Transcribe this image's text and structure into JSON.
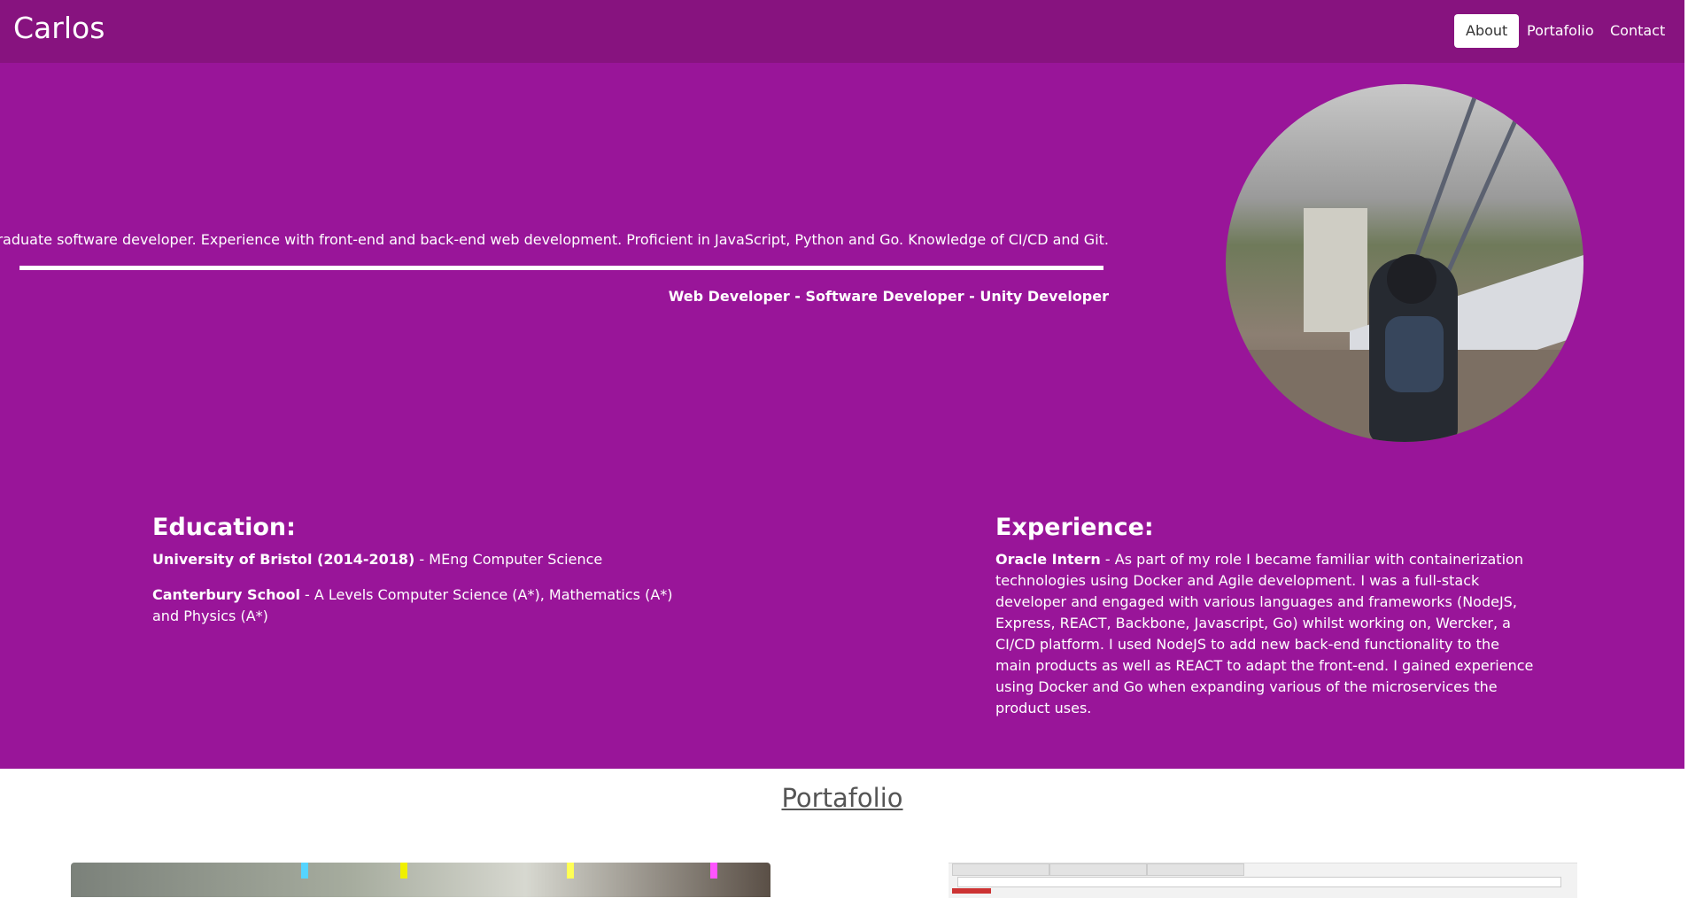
{
  "nav": {
    "brand": "Carlos",
    "items": [
      {
        "label": "About",
        "active": true
      },
      {
        "label": "Portafolio",
        "active": false
      },
      {
        "label": "Contact",
        "active": false
      }
    ]
  },
  "hero": {
    "intro": "Graduate software developer. Experience with front-end and back-end web development. Proficient in JavaScript, Python and Go. Knowledge of CI/CD and Git.",
    "roles": "Web Developer - Software Developer - Unity Developer"
  },
  "education": {
    "title": "Education:",
    "items": [
      {
        "name": "University of Bristol (2014-2018)",
        "detail": " - MEng Computer Science"
      },
      {
        "name": "Canterbury School",
        "detail": " - A Levels Computer Science (A*), Mathematics (A*) and Physics (A*)"
      }
    ]
  },
  "experience": {
    "title": "Experience:",
    "items": [
      {
        "name": "Oracle Intern",
        "detail": " - As part of my role I became familiar with containerization technologies using Docker and Agile development. I was a full-stack developer and engaged with various languages and frameworks (NodeJS, Express, REACT, Backbone, Javascript, Go) whilst working on, Wercker, a CI/CD platform. I used NodeJS to add new back-end functionality to the main products as well as REACT to adapt the front-end. I gained experience using Docker and Go when expanding various of the microservices the product uses."
      }
    ]
  },
  "portfolio": {
    "title": "Portafolio"
  },
  "colors": {
    "navbar": "#87137f",
    "hero": "#991599",
    "text": "#ffffff"
  }
}
